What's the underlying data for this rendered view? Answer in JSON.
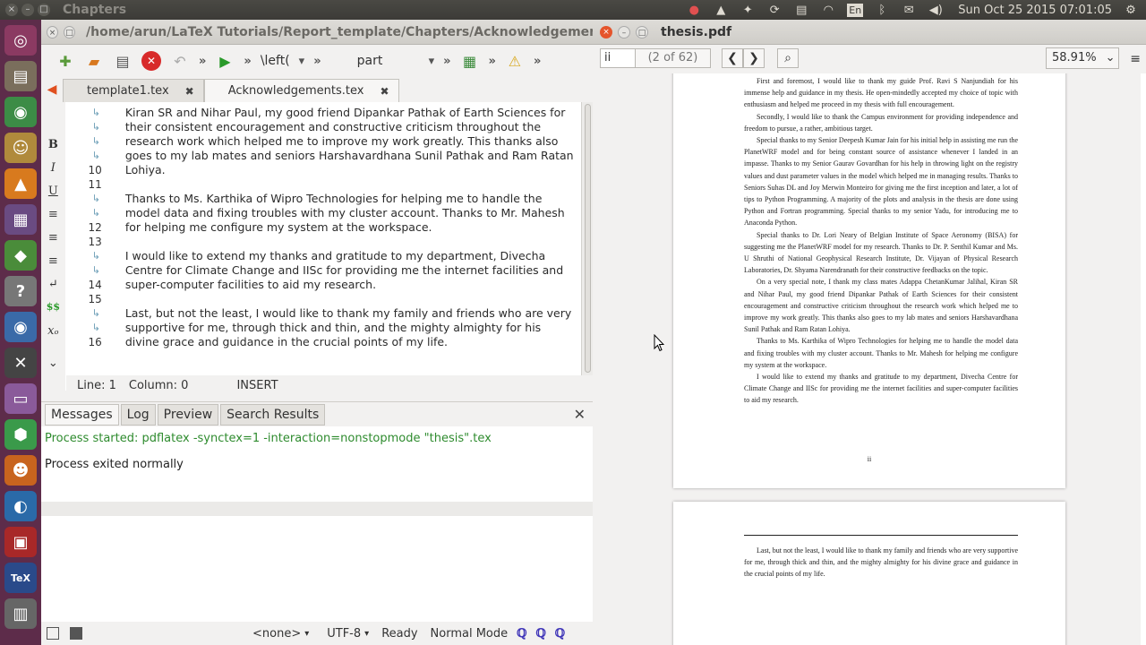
{
  "top_panel": {
    "title": "Chapters",
    "lang": "En",
    "clock": "Sun Oct 25 2015 07:01:05"
  },
  "editor": {
    "path": "/home/arun/LaTeX Tutorials/Report_template/Chapters/Acknowledgements.tex",
    "toolbar": {
      "left_cmd": "\\left(",
      "structure": "part"
    },
    "tabs": [
      {
        "label": "template1.tex"
      },
      {
        "label": "Acknowledgements.tex"
      }
    ],
    "gutter": [
      "↳",
      "↳",
      "↳",
      "↳",
      "10",
      "11",
      "↳",
      "↳",
      "12",
      "13",
      "↳",
      "↳",
      "14",
      "15",
      "↳",
      "↳",
      "16"
    ],
    "lines": [
      "Kiran SR and Nihar Paul, my good friend Dipankar Pathak of Earth Sciences for",
      "their consistent encouragement and constructive criticism throughout the",
      "research work which helped me to improve my work greatly. This thanks also",
      "goes to my lab mates and seniors Harshavardhana Sunil Pathak and Ram Ratan",
      "Lohiya.",
      "",
      "Thanks to Ms. Karthika of Wipro Technologies for helping me to handle the",
      "model data and fixing troubles with my cluster account. Thanks to Mr. Mahesh",
      "for helping me configure my system at the workspace.",
      "",
      "I would like to extend my thanks and gratitude to my department, Divecha",
      "Centre for Climate Change and IISc for providing me the internet facilities and",
      "super-computer facilities to aid my research.",
      "",
      "Last, but not the least, I would like to thank my family and friends who are very",
      "supportive for me, through thick and thin, and the mighty almighty for his",
      "divine grace and guidance in the crucial points of my life."
    ],
    "status": {
      "line": "Line: 1",
      "column": "Column: 0",
      "mode": "INSERT"
    },
    "message_tabs": [
      "Messages",
      "Log",
      "Preview",
      "Search Results"
    ],
    "messages": {
      "started": "Process started: pdflatex -synctex=1 -interaction=nonstopmode \"thesis\".tex",
      "exited": "Process exited normally"
    },
    "bottom_status": {
      "dict": "<none>",
      "encoding": "UTF-8",
      "ready": "Ready",
      "mode": "Normal Mode"
    }
  },
  "pdf": {
    "title": "thesis.pdf",
    "page_input": "ii",
    "page_count": "(2 of 62)",
    "zoom": "58.91%",
    "page_number": "ii",
    "page2_paragraphs": [
      "First and foremost, I would like to thank my guide Prof. Ravi S Nanjundiah for his immense help and guidance in my thesis. He open-mindedly accepted my choice of topic with enthusiasm and helped me proceed in my thesis with full encouragement.",
      "Secondly, I would like to thank the Campus environment for providing independence and freedom to pursue, a rather, ambitious target.",
      "Special thanks to my Senior Deepesh Kumar Jain for his initial help in assisting me run the PlanetWRF model and for being constant source of assistance whenever I landed in an impasse. Thanks to my Senior Gaurav Govardhan for his help in throwing light on the registry values and dust parameter values in the model which helped me in managing results. Thanks to Seniors Suhas DL and Joy Merwin Monteiro for giving me the first inception and later, a lot of tips to Python Programming. A majority of the plots and analysis in the thesis are done using Python and Fortran programming. Special thanks to my senior Yadu, for introducing me to Anaconda Python.",
      "Special thanks to Dr. Lori Neary of Belgian Institute of Space Aeronomy (BISA) for suggesting me the PlanetWRF model for my research. Thanks to Dr. P. Senthil Kumar and Ms. U Shruthi of National Geophysical Research Institute, Dr. Vijayan of Physical Research Laboratories, Dr. Shyama Narendranath for their constructive feedbacks on the topic.",
      "On a very special note, I thank my class mates Adappa ChetanKumar Jalihal, Kiran SR and Nihar Paul, my good friend Dipankar Pathak of Earth Sciences for their consistent encouragement and constructive criticism throughout the research work which helped me to improve my work greatly. This thanks also goes to my lab mates and seniors Harshavardhana Sunil Pathak and Ram Ratan Lohiya.",
      "Thanks to Ms. Karthika of Wipro Technologies for helping me to handle the model data and fixing troubles with my cluster account. Thanks to Mr. Mahesh for helping me configure my system at the workspace.",
      "I would like to extend my thanks and gratitude to my department, Divecha Centre for Climate Change and IISc for providing me the internet facilities and super-computer facilities to aid my research."
    ],
    "page3_paragraph": "Last, but not the least, I would like to thank my family and friends who are very supportive for me, through thick and thin, and the mighty almighty for his divine grace and guidance in the crucial points of my life."
  }
}
